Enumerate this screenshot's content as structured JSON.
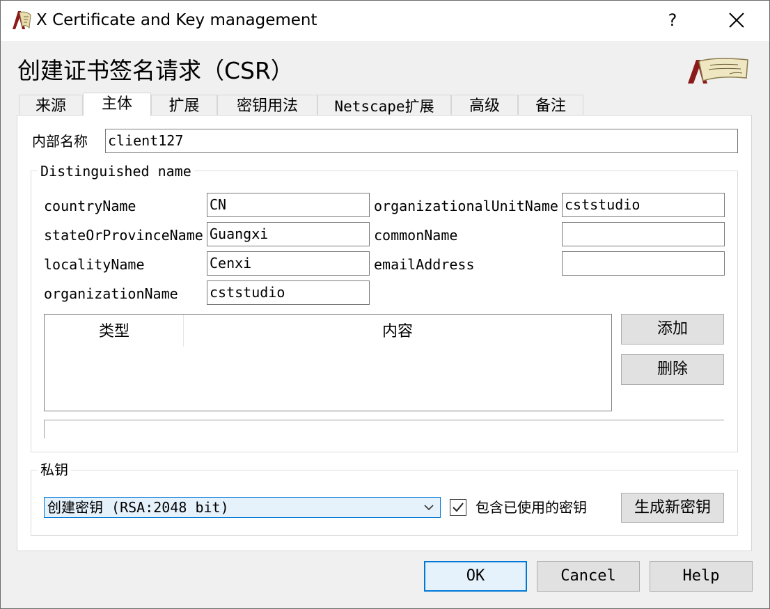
{
  "window": {
    "title": "X Certificate and Key management",
    "help_glyph": "?",
    "icon": "xca-app-icon"
  },
  "dialog": {
    "heading": "创建证书签名请求（CSR）"
  },
  "tabs": [
    {
      "label": "来源",
      "active": false
    },
    {
      "label": "主体",
      "active": true
    },
    {
      "label": "扩展",
      "active": false
    },
    {
      "label": "密钥用法",
      "active": false
    },
    {
      "label": "Netscape扩展",
      "active": false
    },
    {
      "label": "高级",
      "active": false
    },
    {
      "label": "备注",
      "active": false
    }
  ],
  "internal_name": {
    "label": "内部名称",
    "value": "client127"
  },
  "distinguished_name": {
    "title": "Distinguished name",
    "left": [
      {
        "label": "countryName",
        "value": "CN"
      },
      {
        "label": "stateOrProvinceName",
        "value": "Guangxi"
      },
      {
        "label": "localityName",
        "value": "Cenxi"
      },
      {
        "label": "organizationName",
        "value": "cststudio"
      }
    ],
    "right": [
      {
        "label": "organizationalUnitName",
        "value": "cststudio"
      },
      {
        "label": "commonName",
        "value": ""
      },
      {
        "label": "emailAddress",
        "value": ""
      }
    ],
    "table": {
      "columns": [
        "类型",
        "内容"
      ],
      "rows": []
    },
    "add_label": "添加",
    "delete_label": "删除"
  },
  "private_key": {
    "title": "私钥",
    "selected": "创建密钥 (RSA:2048 bit)",
    "include_used_label": "包含已使用的密钥",
    "include_used_checked": true,
    "generate_label": "生成新密钥"
  },
  "footer": {
    "ok_label": "OK",
    "cancel_label": "Cancel",
    "help_label": "Help"
  },
  "colors": {
    "accent": "#0078d7",
    "window_bg": "#f0f0f0"
  }
}
